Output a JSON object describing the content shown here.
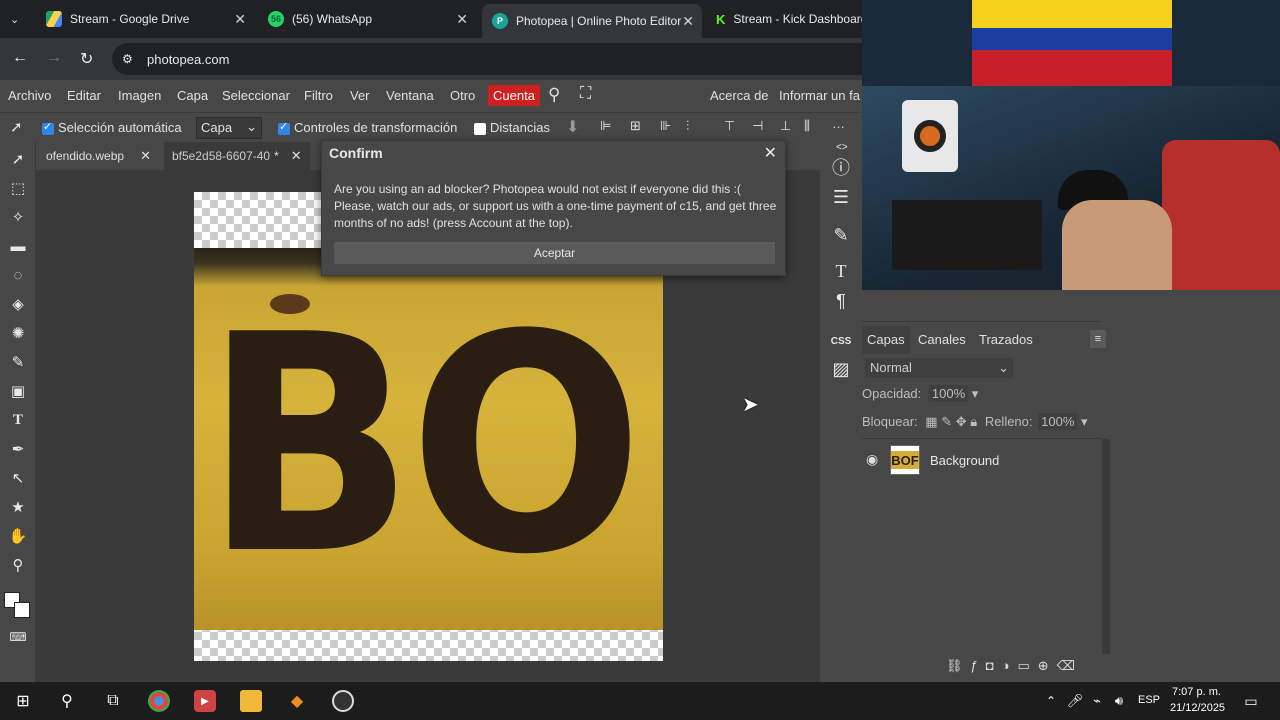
{
  "browser": {
    "tabs": [
      {
        "title": "Stream - Google Drive",
        "icon": "drive-icon"
      },
      {
        "title": "(56) WhatsApp",
        "icon": "whatsapp-icon",
        "badge": "56"
      },
      {
        "title": "Photopea | Online Photo Editor",
        "icon": "photopea-icon"
      },
      {
        "title": "Stream - Kick Dashboard",
        "icon": "kick-icon"
      }
    ],
    "url": "photopea.com"
  },
  "menu": {
    "items": [
      "Archivo",
      "Editar",
      "Imagen",
      "Capa",
      "Seleccionar",
      "Filtro",
      "Ver",
      "Ventana",
      "Otro"
    ],
    "account": "Cuenta",
    "about": "Acerca de",
    "report": "Informar un fa"
  },
  "options": {
    "auto_select": "Selección automática",
    "capa": "Capa",
    "transform_controls": "Controles de transformación",
    "distances": "Distancias"
  },
  "documents": [
    {
      "name": "ofendido.webp"
    },
    {
      "name": "bf5e2d58-6607-40",
      "modified": "*"
    }
  ],
  "canvas": {
    "plate_text": "BOF"
  },
  "dialog": {
    "title": "Confirm",
    "message": "Are you using an ad blocker? Photopea would not exist if everyone did this :( Please, watch our ads, or support us with a one-time payment of c15, and get three months of no ads! (press Account at the top).",
    "button": "Aceptar"
  },
  "layers_panel": {
    "tabs": [
      "Capas",
      "Canales",
      "Trazados"
    ],
    "blend_mode": "Normal",
    "opacity_label": "Opacidad:",
    "opacity": "100%",
    "lock_label": "Bloquear:",
    "fill_label": "Relleno:",
    "fill": "100%",
    "layers": [
      {
        "name": "Background",
        "visible": true
      }
    ]
  },
  "right_strip": {
    "css_label": "CSS"
  },
  "taskbar": {
    "language": "ESP",
    "time": "7:07 p. m.",
    "date": "21/12/2025"
  },
  "colors": {
    "accent_red": "#cf2020",
    "checkbox_blue": "#2f86e8",
    "plate_yellow": "#d6b33b"
  }
}
